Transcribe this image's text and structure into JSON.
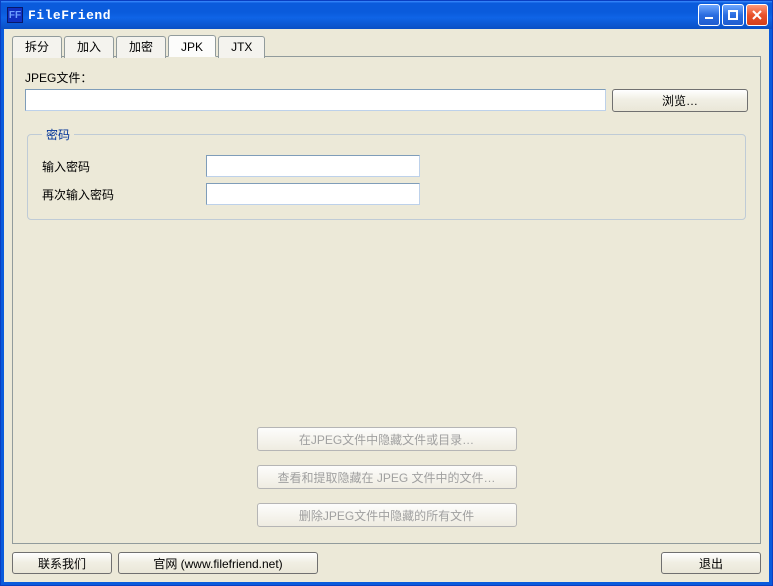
{
  "window": {
    "title": "FileFriend",
    "icon_text": "FF"
  },
  "tabs": [
    {
      "label": "拆分",
      "active": false
    },
    {
      "label": "加入",
      "active": false
    },
    {
      "label": "加密",
      "active": false
    },
    {
      "label": "JPK",
      "active": true
    },
    {
      "label": "JTX",
      "active": false
    }
  ],
  "jpk": {
    "jpeg_label": "JPEG文件：",
    "jpeg_value": "",
    "browse_label": "浏览…",
    "group_title": "密码",
    "password_label": "输入密码",
    "password_value": "",
    "confirm_label": "再次输入密码",
    "confirm_value": "",
    "action_hide": "在JPEG文件中隐藏文件或目录…",
    "action_extract": "查看和提取隐藏在 JPEG 文件中的文件…",
    "action_delete": "删除JPEG文件中隐藏的所有文件"
  },
  "footer": {
    "contact": "联系我们",
    "site": "官网 (www.filefriend.net)",
    "exit": "退出"
  }
}
